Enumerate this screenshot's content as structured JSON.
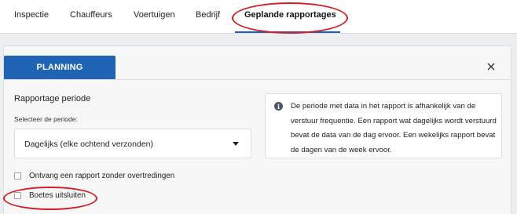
{
  "tabs": [
    {
      "label": "Inspectie"
    },
    {
      "label": "Chauffeurs"
    },
    {
      "label": "Voertuigen"
    },
    {
      "label": "Bedrijf"
    },
    {
      "label": "Geplande rapportages",
      "active": true
    }
  ],
  "panel": {
    "planning_button": "PLANNING",
    "close_icon": "close-icon",
    "section_title": "Rapportage periode",
    "select_label": "Selecteer de periode:",
    "select_value": "Dagelijks (elke ochtend verzonden)",
    "info_icon": "info-icon",
    "info_text": "De periode met data in het rapport is afhankelijk van de verstuur frequentie. Een rapport wat dagelijks wordt verstuurd bevat de data van de dag ervoor. Een wekelijks rapport bevat de dagen van de week ervoor.",
    "checkboxes": [
      {
        "label": "Ontvang een rapport zonder overtredingen",
        "checked": false
      },
      {
        "label": "Boetes uitsluiten",
        "checked": false
      }
    ]
  },
  "colors": {
    "accent": "#1f63b4",
    "annotation": "#d42027",
    "background": "#eceef0"
  }
}
